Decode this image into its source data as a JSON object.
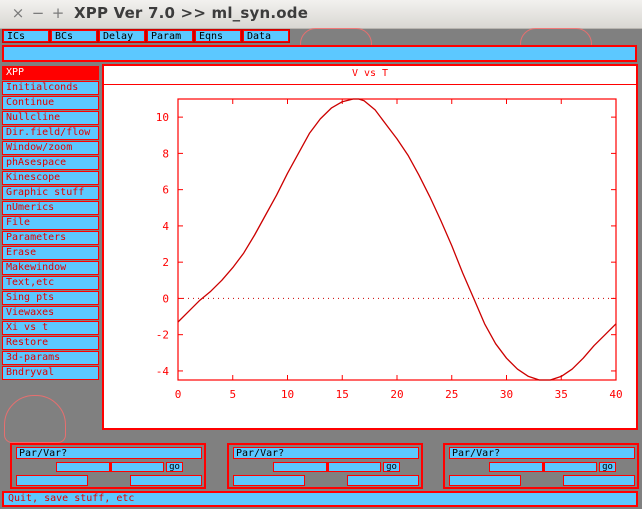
{
  "window": {
    "title": "XPP Ver 7.0 >> ml_syn.ode",
    "close_glyph": "×",
    "minimize_glyph": "−",
    "maximize_glyph": "+"
  },
  "toolbar": {
    "buttons": [
      "ICs",
      "BCs",
      "Delay",
      "Param",
      "Eqns",
      "Data"
    ]
  },
  "command_line": {
    "value": ""
  },
  "menu": {
    "items": [
      "XPP",
      "Initialconds",
      "Continue",
      "Nullcline",
      "Dir.field/flow",
      "Window/zoom",
      "phAsespace",
      "Kinescope",
      "Graphic stuff",
      "nUmerics",
      "File",
      "Parameters",
      "Erase",
      "Makewindow",
      "Text,etc",
      "Sing pts",
      "Viewaxes",
      "Xi vs t",
      "Restore",
      "3d-params",
      "Bndryval"
    ]
  },
  "graph": {
    "title": "V vs T",
    "colors": {
      "line": "#cc0000",
      "frame": "#ff0000",
      "zero_line": "#cc0000"
    }
  },
  "chart_data": {
    "type": "line",
    "title": "V vs T",
    "xlabel": "",
    "ylabel": "",
    "xlim": [
      0,
      40
    ],
    "ylim": [
      -4.5,
      11
    ],
    "xticks": [
      0,
      5,
      10,
      15,
      20,
      25,
      30,
      35,
      40
    ],
    "yticks": [
      10,
      8,
      6,
      4,
      2,
      0,
      -2,
      -4
    ],
    "grid": false,
    "zero_line": true,
    "series": [
      {
        "x": [
          0,
          1,
          2,
          3,
          4,
          5,
          6,
          7,
          8,
          9,
          10,
          11,
          12,
          13,
          14,
          15,
          16,
          16.5,
          17,
          18,
          19,
          20,
          21,
          22,
          23,
          24,
          25,
          26,
          27,
          28,
          29,
          30,
          31,
          32,
          33,
          34,
          35,
          36,
          37,
          38,
          39,
          40.5
        ],
        "y": [
          -1.3,
          -0.7,
          -0.1,
          0.4,
          1.0,
          1.7,
          2.5,
          3.5,
          4.6,
          5.7,
          6.9,
          8.0,
          9.1,
          9.9,
          10.5,
          10.85,
          11.0,
          11.0,
          10.9,
          10.4,
          9.6,
          8.8,
          7.9,
          6.8,
          5.6,
          4.3,
          2.9,
          1.4,
          0.0,
          -1.4,
          -2.5,
          -3.3,
          -3.9,
          -4.3,
          -4.5,
          -4.5,
          -4.3,
          -3.9,
          -3.3,
          -2.6,
          -2.0,
          -1.4
        ]
      }
    ]
  },
  "sliders": [
    {
      "label": "Par/Var?",
      "go_label": "go",
      "thumb": 0.5
    },
    {
      "label": "Par/Var?",
      "go_label": "go",
      "thumb": 0.5
    },
    {
      "label": "Par/Var?",
      "go_label": "go",
      "thumb": 0.5
    }
  ],
  "status": {
    "text": "Quit, save stuff, etc"
  }
}
